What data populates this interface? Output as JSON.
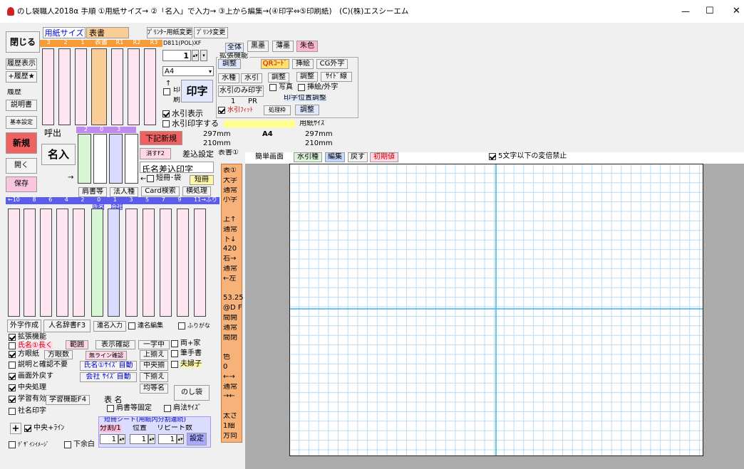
{
  "title_bar": {
    "text": "のし袋職人2018α 手順 ①用紙サイズ→ ②「名入」で入力→ ③上から編集→(④印字⇔⑤印刷紙)　(C)(株)エスシーエム",
    "minimize": "—",
    "maximize": "☐",
    "close": "✕"
  },
  "left": {
    "close": "閉じる",
    "history": "履歴表示",
    "history_add": "+履歴★",
    "history2": "履歴",
    "manual": "説明書",
    "basic": "基本設定",
    "new": "新規",
    "open": "開く",
    "save": "保存"
  },
  "paper": {
    "label": "用紙サイズ",
    "value": "表書",
    "printer_paper": "ﾌﾟﾘﾝﾀｰ用紙変更",
    "printer_change": "ﾌﾟﾘﾝﾀ変更",
    "printer_name": "D811(POL)XF",
    "size": "A4",
    "copies": "1"
  },
  "col_headers_top": [
    "3",
    "2",
    "1",
    "表書",
    "R1",
    "R2",
    "R3"
  ],
  "caller": {
    "label": "呼出",
    "name_btn": "名入",
    "arrow": "→",
    "nums": [
      "2",
      "0",
      "3"
    ]
  },
  "print": {
    "big": "印字",
    "print_label": "印\n刷",
    "up": "↑",
    "pr_num": "1",
    "pr": "PR"
  },
  "color": {
    "all": "全体",
    "black": "黒墨",
    "light": "薄墨",
    "red": "朱色"
  },
  "ext": {
    "label": "拡張機能",
    "adjust": "調整",
    "qr": "QRｺｰﾄﾞ",
    "insert": "挿絵",
    "cg": "CG外字",
    "mizuhiki": "水引",
    "mizutype": "水種",
    "mizu_only": "水引のみ印字",
    "adj2": "調整",
    "photo": "写真",
    "adj3": "調整",
    "side": "ｻｲﾄﾞ線",
    "insert_ext": "挿絵/外字",
    "pos_adj": "印字位置調整",
    "fit": "水引ﾌｨｯﾄ",
    "frame": "処理枠",
    "adj4": "調整"
  },
  "checks": {
    "mizu_show": "水引表示",
    "mizu_print": "水引印字する",
    "paper_size": "用紙ｻｲｽﾞ"
  },
  "dims": {
    "w1": "297mm",
    "h1": "210mm",
    "size_mid": "A4",
    "w2": "297mm",
    "h2": "210mm"
  },
  "sub": {
    "lower_new": "下記新規",
    "erase": "消すF2",
    "insert_set": "差込設定",
    "front1": "表書①",
    "name_insert": "氏名差込印字",
    "left_arrow": "←",
    "short_bag": "短冊･袋",
    "short": "短冊",
    "katagaki": "肩書等",
    "corp": "法人種",
    "card": "Card検索",
    "horiz": "横処理"
  },
  "scale": {
    "nums": [
      "←10",
      "8",
      "6",
      "4",
      "2",
      "0",
      "1",
      "3",
      "5",
      "7",
      "9",
      "11→ふり"
    ],
    "name": "氏名",
    "company": "会社"
  },
  "bottom_btns": {
    "ext_char": "外字作成",
    "dict": "人名辞書F3",
    "renmei": "連名入力",
    "renmei_edit": "連名編集",
    "furigana": "ふりがな"
  },
  "opts": {
    "ext": "拡張機能",
    "long": "氏名①長く",
    "range": "範囲",
    "disp_check": "表示確認",
    "ichiji": "一字中",
    "both_house": "両+家",
    "grid": "方眼紙",
    "grid_num": "方眼数",
    "line_check": "無ライン確認",
    "top": "上揃え",
    "brush": "筆手書",
    "no_confirm": "説明と確認不要",
    "auto_size": "氏名①ｻｲｽﾞ自動",
    "center": "中央揃",
    "couple": "夫婦子",
    "out_back": "画面外戻す",
    "company_auto": "会社 ｻｲｽﾞ自動",
    "bottom": "下揃え",
    "center_proc": "中央処理",
    "equal": "均等名",
    "noshi": "のし袋",
    "learn": "学習有効",
    "learn_f4": "学習機能F4",
    "front_name": "表 名",
    "kata_fix": "肩書等固定",
    "corp_size": "肩法ｻｲｽﾞ",
    "company_print": "社名印字",
    "plus": "+",
    "center_line": "中央+ﾗｲﾝ",
    "split_title": "短冊シート(用紙内分割連続)",
    "split": "分割/1",
    "pos": "位置",
    "repeat": "リピート数",
    "set": "設定",
    "design": "ﾃﾞｻﾞｲﾝｲﾒｰｼﾞ",
    "margin": "下余白",
    "s1": "1",
    "s2": "1",
    "s3": "1"
  },
  "side_items": [
    "表①",
    "大字",
    "通常",
    "小字",
    "",
    "上↑",
    "通常",
    "下↓",
    "420",
    "右→",
    "通常",
    "←左",
    "",
    "53.25",
    "@D F",
    "間開",
    "通常",
    "間閉",
    "",
    "色",
    "0",
    "←→",
    "通常",
    "→←",
    "",
    "太さ",
    "1細",
    "方向"
  ],
  "canvas_bar": {
    "simple": "簡単画面",
    "mizu": "水引種",
    "edit": "編集",
    "back": "戻す",
    "init": "初期値",
    "five": "5文字以下の変倍禁止"
  }
}
